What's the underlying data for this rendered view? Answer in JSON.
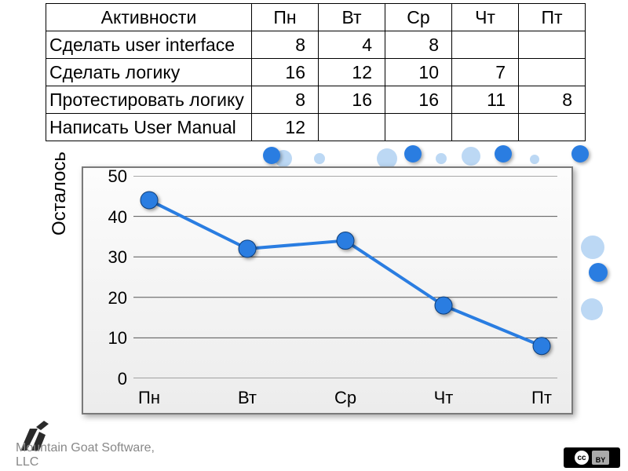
{
  "table": {
    "header_activity": "Активности",
    "days": [
      "Пн",
      "Вт",
      "Ср",
      "Чт",
      "Пт"
    ],
    "rows": [
      {
        "activity": "Сделать user interface",
        "values": [
          "8",
          "4",
          "8",
          "",
          ""
        ]
      },
      {
        "activity": "Сделать логику",
        "values": [
          "16",
          "12",
          "10",
          "7",
          ""
        ]
      },
      {
        "activity": "Протестировать логику",
        "values": [
          "8",
          "16",
          "16",
          "11",
          "8"
        ]
      },
      {
        "activity": "Написать User Manual",
        "values": [
          "12",
          "",
          "",
          "",
          ""
        ]
      }
    ]
  },
  "chart_data": {
    "type": "line",
    "title": "",
    "xlabel": "",
    "ylabel": "Осталось",
    "categories": [
      "Пн",
      "Вт",
      "Ср",
      "Чт",
      "Пт"
    ],
    "x_ticks": [
      "Пн",
      "Вт",
      "Ср",
      "Чт",
      "Пт"
    ],
    "y_ticks": [
      0,
      10,
      20,
      30,
      40,
      50
    ],
    "ylim": [
      0,
      50
    ],
    "grid": true,
    "series": [
      {
        "name": "Осталось",
        "values": [
          44,
          32,
          34,
          18,
          8
        ]
      }
    ],
    "colors": {
      "line": "#2a7de1",
      "marker": "#2a7de1"
    }
  },
  "footer": {
    "line1": "Mountain Goat Software,",
    "line2": "LLC",
    "cc_label": "BY"
  }
}
